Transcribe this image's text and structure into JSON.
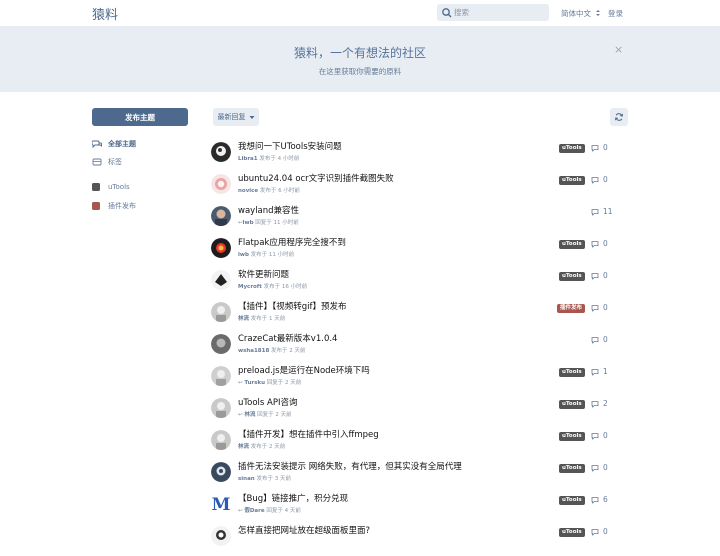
{
  "header": {
    "brand": "猿料",
    "search_placeholder": "搜索",
    "language": "简体中文",
    "login": "登录"
  },
  "hero": {
    "title": "猿料，一个有想法的社区",
    "subtitle": "在这里获取你需要的原料",
    "close": "×"
  },
  "sidebar": {
    "new_post": "发布主题",
    "items": [
      {
        "label": "全部主题",
        "icon": "comments-icon",
        "active": true
      },
      {
        "label": "标签",
        "icon": "tags-icon",
        "active": false
      }
    ],
    "tags": [
      {
        "label": "uTools",
        "color": "#555555"
      },
      {
        "label": "插件发布",
        "color": "#a8574f"
      }
    ]
  },
  "toolbar": {
    "sort": "最新回复",
    "refresh": "refresh-icon"
  },
  "colors": {
    "primary": "#4d698e",
    "utools_tag": "#555555",
    "plugin_tag": "#a8574f"
  },
  "discussions": [
    {
      "title": "我想问一下UTools安装问题",
      "user": "Libra1",
      "action": "发布于 4 小时前",
      "reply": false,
      "tag": "uTools",
      "count": "0"
    },
    {
      "title": "ubuntu24.04 ocr文字识别插件截图失败",
      "user": "novice",
      "action": "发布于 6 小时前",
      "reply": false,
      "tag": "uTools",
      "count": "0"
    },
    {
      "title": "wayland兼容性",
      "user": "lwb",
      "action": "回复于 11 小时前",
      "reply": true,
      "tag": "",
      "count": "11"
    },
    {
      "title": "Flatpak应用程序完全搜不到",
      "user": "lwb",
      "action": "发布于 11 小时前",
      "reply": false,
      "tag": "uTools",
      "count": "0"
    },
    {
      "title": "软件更新问题",
      "user": "Mycroft",
      "action": "发布于 16 小时前",
      "reply": false,
      "tag": "uTools",
      "count": "0"
    },
    {
      "title": "【插件】【视频转gif】预发布",
      "user": "林流",
      "action": "发布于 1 天前",
      "reply": false,
      "tag": "插件发布",
      "count": "0"
    },
    {
      "title": "CrazeCat最新版本v1.0.4",
      "user": "wsha1818",
      "action": "发布于 2 天前",
      "reply": false,
      "tag": "",
      "count": "0"
    },
    {
      "title": "preload.js是运行在Node环境下吗",
      "user": "Tursku",
      "action": "回复于 2 天前",
      "reply": true,
      "tag": "uTools",
      "count": "1"
    },
    {
      "title": "uTools API咨询",
      "user": "林流",
      "action": "回复于 2 天前",
      "reply": true,
      "tag": "uTools",
      "count": "2"
    },
    {
      "title": "【插件开发】想在插件中引入ffmpeg",
      "user": "林流",
      "action": "发布于 2 天前",
      "reply": false,
      "tag": "uTools",
      "count": "0"
    },
    {
      "title": "插件无法安装提示 网络失败，有代理，但其实没有全局代理",
      "user": "sinan",
      "action": "发布于 3 天前",
      "reply": false,
      "tag": "uTools",
      "count": "0"
    },
    {
      "title": "【Bug】链接推广，积分兑现",
      "user": "假Dare",
      "action": "回复于 4 天前",
      "reply": true,
      "tag": "uTools",
      "count": "6"
    },
    {
      "title": "怎样直接把网址放在超级面板里面?",
      "user": "",
      "action": "",
      "reply": false,
      "tag": "uTools",
      "count": "0"
    }
  ]
}
